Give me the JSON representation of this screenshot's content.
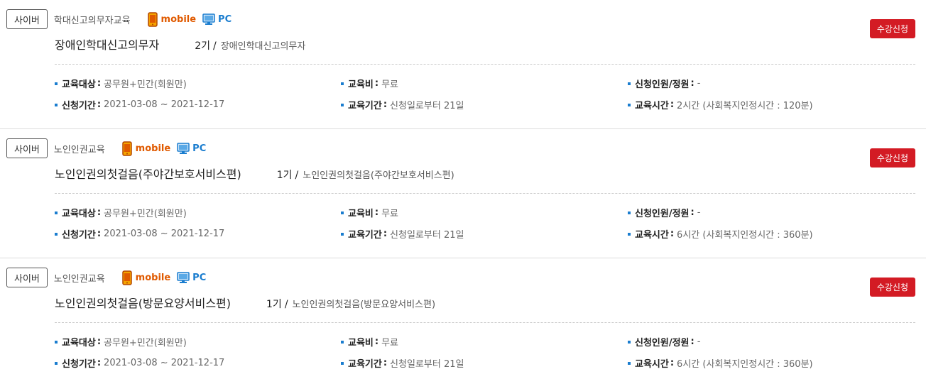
{
  "courses": [
    {
      "badge": "사이버",
      "category": "학대신고의무자교육",
      "mobile_label": "mobile",
      "pc_label": "PC",
      "title": "장애인학대신고의무자",
      "round": "2기",
      "slash": "/",
      "subtitle": "장애인학대신고의무자",
      "apply_label": "수강신청",
      "info": {
        "target_label": "교육대상",
        "target_value": "공무원+민간(회원만)",
        "fee_label": "교육비",
        "fee_value": "무료",
        "capacity_label": "신청인원/정원",
        "capacity_value": "-",
        "period_label": "신청기간",
        "period_value": "2021-03-08 ~ 2021-12-17",
        "duration_label": "교육기간",
        "duration_value": "신청일로부터 21일",
        "hours_label": "교육시간",
        "hours_value": "2시간 (사회복지인정시간 : 120분)"
      }
    },
    {
      "badge": "사이버",
      "category": "노인인권교육",
      "mobile_label": "mobile",
      "pc_label": "PC",
      "title": "노인인권의첫걸음(주야간보호서비스편)",
      "round": "1기",
      "slash": "/",
      "subtitle": "노인인권의첫걸음(주야간보호서비스편)",
      "apply_label": "수강신청",
      "info": {
        "target_label": "교육대상",
        "target_value": "공무원+민간(회원만)",
        "fee_label": "교육비",
        "fee_value": "무료",
        "capacity_label": "신청인원/정원",
        "capacity_value": "-",
        "period_label": "신청기간",
        "period_value": "2021-03-08 ~ 2021-12-17",
        "duration_label": "교육기간",
        "duration_value": "신청일로부터 21일",
        "hours_label": "교육시간",
        "hours_value": "6시간 (사회복지인정시간 : 360분)"
      }
    },
    {
      "badge": "사이버",
      "category": "노인인권교육",
      "mobile_label": "mobile",
      "pc_label": "PC",
      "title": "노인인권의첫걸음(방문요양서비스편)",
      "round": "1기",
      "slash": "/",
      "subtitle": "노인인권의첫걸음(방문요양서비스편)",
      "apply_label": "수강신청",
      "info": {
        "target_label": "교육대상",
        "target_value": "공무원+민간(회원만)",
        "fee_label": "교육비",
        "fee_value": "무료",
        "capacity_label": "신청인원/정원",
        "capacity_value": "-",
        "period_label": "신청기간",
        "period_value": "2021-03-08 ~ 2021-12-17",
        "duration_label": "교육기간",
        "duration_value": "신청일로부터 21일",
        "hours_label": "교육시간",
        "hours_value": "6시간 (사회복지인정시간 : 360분)"
      }
    }
  ],
  "icons": {
    "mobile": "mobile-phone-icon",
    "pc": "desktop-monitor-icon",
    "bullet": "square-bullet-icon"
  },
  "colors": {
    "apply_button": "#d31b24",
    "mobile": "#e05a00",
    "pc": "#1a7dcf",
    "bullet": "#1a7dcf"
  }
}
